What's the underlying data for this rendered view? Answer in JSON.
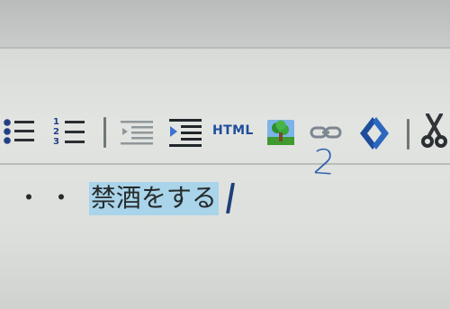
{
  "toolbar": {
    "buttons": [
      {
        "name": "bulleted-list-icon"
      },
      {
        "name": "numbered-list-icon"
      },
      {
        "name": "outdent-icon"
      },
      {
        "name": "indent-icon"
      },
      {
        "name": "html-label",
        "label": "HTML"
      },
      {
        "name": "image-icon"
      },
      {
        "name": "link-icon"
      },
      {
        "name": "source-code-icon"
      },
      {
        "name": "cut-icon"
      }
    ]
  },
  "annotation": {
    "handwritten_number": "2"
  },
  "editor": {
    "bullets": "・・",
    "selected_text": "禁酒をする"
  },
  "colors": {
    "selection_highlight": "#a9d4ea",
    "toolbar_icon_blue": "#1f4d9c",
    "annotation_blue": "#2f5fae"
  }
}
